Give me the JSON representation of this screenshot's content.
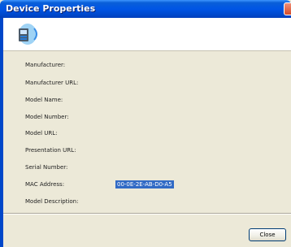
{
  "window": {
    "title": "Device Properties"
  },
  "fields": [
    {
      "label": "Manufacturer:"
    },
    {
      "label": "Manufacturer URL:"
    },
    {
      "label": "Model Name:"
    },
    {
      "label": "Model Number:"
    },
    {
      "label": "Model URL:"
    },
    {
      "label": "Presentation URL:"
    },
    {
      "label": "Serial Number:"
    },
    {
      "label": "MAC Address:",
      "value": "00-0E-2E-AB-D0-A5"
    },
    {
      "label": "Model Description:"
    }
  ],
  "buttons": {
    "close_label": "Close"
  },
  "icons": {
    "device": "network-device-icon",
    "title_close": "close-icon"
  }
}
